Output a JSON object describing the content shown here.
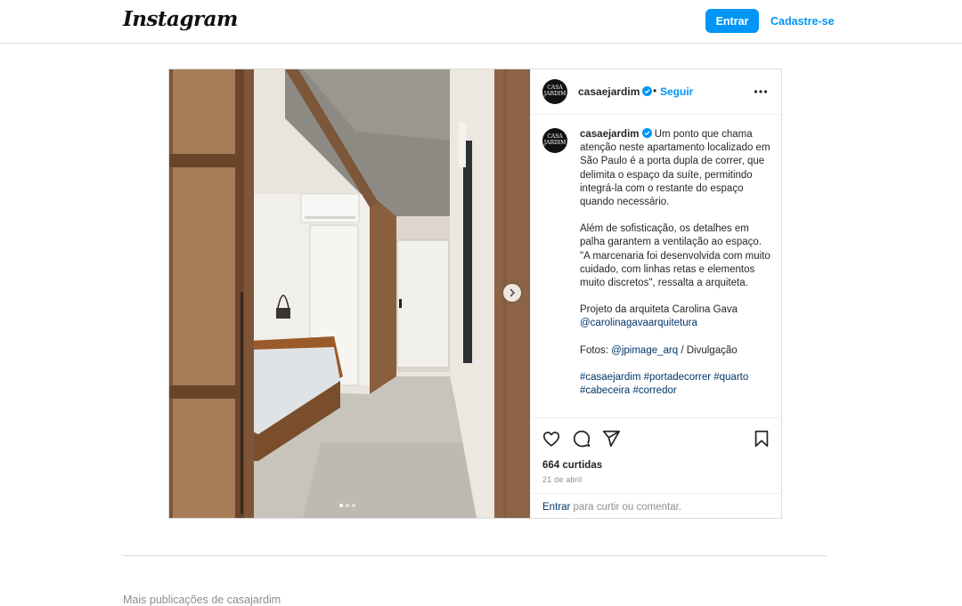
{
  "header": {
    "logo": "Instagram",
    "login_button": "Entrar",
    "signup_link": "Cadastre-se"
  },
  "post": {
    "account": {
      "username": "casaejardim",
      "avatar_text_top": "CASA",
      "avatar_text_small": "e",
      "avatar_text_bottom": "JARDIM",
      "separator": "•",
      "follow": "Seguir"
    },
    "carousel": {
      "total_images": 3,
      "current_index": 1
    },
    "caption": {
      "username": "casaejardim",
      "paragraph_1": "Um ponto que chama atenção neste apartamento localizado em São Paulo é a porta dupla de correr, que delimita o espaço da suíte, permitindo integrá-la com o restante do espaço quando necessário.",
      "paragraph_2": "Além de sofisticação, os detalhes em palha garantem a ventilação ao espaço. \"A marcenaria foi desenvolvida com muito cuidado, com linhas retas e elementos muito discretos\", ressalta a arquiteta.",
      "paragraph_3_text": "Projeto da arquiteta Carolina Gava",
      "paragraph_3_mention": "@carolinagavaarquitetura",
      "photo_credit_prefix": "Fotos:",
      "photo_credit_mention": "@jpimage_arq",
      "photo_credit_suffix": "/ Divulgação",
      "hashtags": [
        "#casaejardim",
        "#portadecorrer",
        "#quarto",
        "#cabeceira",
        "#corredor"
      ]
    },
    "likes": "664 curtidas",
    "date": "21 de abril",
    "login_prompt_link": "Entrar",
    "login_prompt_text": "para curtir ou comentar."
  },
  "footer": {
    "more_posts": "Mais publicações de casajardim"
  },
  "icons": {
    "like": "heart-icon",
    "comment": "comment-icon",
    "share": "paper-plane-icon",
    "save": "bookmark-icon",
    "more": "more-options-icon",
    "verified": "verified-badge-icon",
    "next": "chevron-right-icon"
  },
  "colors": {
    "accent": "#0095f6",
    "link": "#00376b",
    "muted": "#8e8e8e",
    "border": "#dbdbdb"
  }
}
